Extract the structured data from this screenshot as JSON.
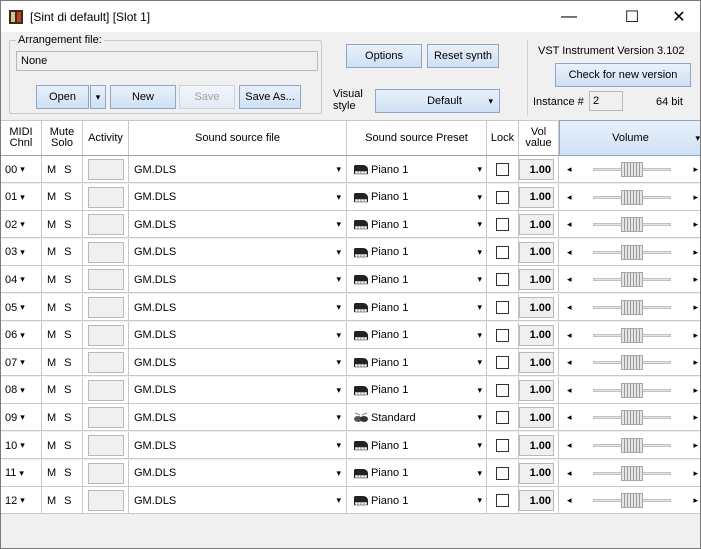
{
  "window": {
    "title": "[Sint di default] [Slot 1]",
    "minimize_glyph": "—",
    "maximize_glyph": "☐",
    "close_glyph": "✕"
  },
  "arrangement": {
    "legend": "Arrangement file:",
    "value": "None",
    "open_label": "Open",
    "open_dropdown_glyph": "▾",
    "new_label": "New",
    "save_label": "Save",
    "save_as_label": "Save As..."
  },
  "options_label": "Options",
  "reset_synth_label": "Reset synth",
  "visual_style": {
    "label_line1": "Visual",
    "label_line2": "style",
    "value": "Default",
    "dropdown_glyph": "▾"
  },
  "vst": {
    "version_label": "VST Instrument Version 3.102",
    "check_label": "Check for new version",
    "instance_label": "Instance #",
    "instance_value": "2",
    "bits_label": "64 bit"
  },
  "columns": {
    "midi_chnl_1": "MIDI",
    "midi_chnl_2": "Chnl",
    "mute_solo_1": "Mute",
    "mute_solo_2": "Solo",
    "activity": "Activity",
    "sound_source_file": "Sound source file",
    "sound_source_preset": "Sound source Preset",
    "lock": "Lock",
    "vol_value_1": "Vol",
    "vol_value_2": "value",
    "volume": "Volume",
    "volume_dropdown_glyph": "▾"
  },
  "rows": [
    {
      "channel": "00",
      "mute": "M",
      "solo": "S",
      "file": "GM.DLS",
      "preset": "Piano 1",
      "preset_icon": "piano-icon",
      "vol": "1.00",
      "slider": 0.5
    },
    {
      "channel": "01",
      "mute": "M",
      "solo": "S",
      "file": "GM.DLS",
      "preset": "Piano 1",
      "preset_icon": "piano-icon",
      "vol": "1.00",
      "slider": 0.5
    },
    {
      "channel": "02",
      "mute": "M",
      "solo": "S",
      "file": "GM.DLS",
      "preset": "Piano 1",
      "preset_icon": "piano-icon",
      "vol": "1.00",
      "slider": 0.5
    },
    {
      "channel": "03",
      "mute": "M",
      "solo": "S",
      "file": "GM.DLS",
      "preset": "Piano 1",
      "preset_icon": "piano-icon",
      "vol": "1.00",
      "slider": 0.5
    },
    {
      "channel": "04",
      "mute": "M",
      "solo": "S",
      "file": "GM.DLS",
      "preset": "Piano 1",
      "preset_icon": "piano-icon",
      "vol": "1.00",
      "slider": 0.5
    },
    {
      "channel": "05",
      "mute": "M",
      "solo": "S",
      "file": "GM.DLS",
      "preset": "Piano 1",
      "preset_icon": "piano-icon",
      "vol": "1.00",
      "slider": 0.5
    },
    {
      "channel": "06",
      "mute": "M",
      "solo": "S",
      "file": "GM.DLS",
      "preset": "Piano 1",
      "preset_icon": "piano-icon",
      "vol": "1.00",
      "slider": 0.5
    },
    {
      "channel": "07",
      "mute": "M",
      "solo": "S",
      "file": "GM.DLS",
      "preset": "Piano 1",
      "preset_icon": "piano-icon",
      "vol": "1.00",
      "slider": 0.5
    },
    {
      "channel": "08",
      "mute": "M",
      "solo": "S",
      "file": "GM.DLS",
      "preset": "Piano 1",
      "preset_icon": "piano-icon",
      "vol": "1.00",
      "slider": 0.5
    },
    {
      "channel": "09",
      "mute": "M",
      "solo": "S",
      "file": "GM.DLS",
      "preset": "Standard",
      "preset_icon": "drum-kit-icon",
      "vol": "1.00",
      "slider": 0.5
    },
    {
      "channel": "10",
      "mute": "M",
      "solo": "S",
      "file": "GM.DLS",
      "preset": "Piano 1",
      "preset_icon": "piano-icon",
      "vol": "1.00",
      "slider": 0.5
    },
    {
      "channel": "11",
      "mute": "M",
      "solo": "S",
      "file": "GM.DLS",
      "preset": "Piano 1",
      "preset_icon": "piano-icon",
      "vol": "1.00",
      "slider": 0.5
    },
    {
      "channel": "12",
      "mute": "M",
      "solo": "S",
      "file": "GM.DLS",
      "preset": "Piano 1",
      "preset_icon": "piano-icon",
      "vol": "1.00",
      "slider": 0.5
    }
  ],
  "glyphs": {
    "dropdown": "▾",
    "arrow_left": "◂",
    "arrow_right": "▸"
  }
}
